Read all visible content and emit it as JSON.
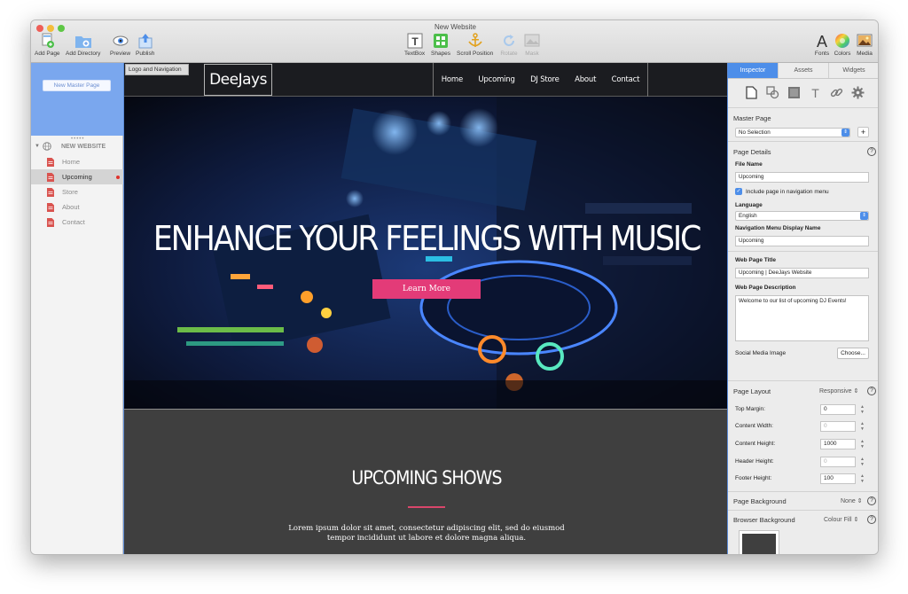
{
  "window": {
    "title": "New Website"
  },
  "toolbar": {
    "left": [
      {
        "label": "Add Page",
        "icon": "add-page-icon"
      },
      {
        "label": "Add Directory",
        "icon": "add-directory-icon"
      },
      {
        "label": "Preview",
        "icon": "preview-eye-icon"
      },
      {
        "label": "Publish",
        "icon": "publish-icon"
      }
    ],
    "center": [
      {
        "label": "TextBox",
        "icon": "textbox-icon"
      },
      {
        "label": "Shapes",
        "icon": "shapes-icon"
      },
      {
        "label": "Scroll Position",
        "icon": "anchor-icon"
      },
      {
        "label": "Rotate",
        "icon": "rotate-icon"
      },
      {
        "label": "Mask",
        "icon": "mask-icon"
      }
    ],
    "right": [
      {
        "label": "Fonts",
        "icon": "fonts-icon"
      },
      {
        "label": "Colors",
        "icon": "colors-icon"
      },
      {
        "label": "Media",
        "icon": "media-icon"
      }
    ]
  },
  "sidebar": {
    "master_button": "New Master Page",
    "site_name": "NEW WEBSITE",
    "pages": [
      {
        "label": "Home"
      },
      {
        "label": "Upcoming"
      },
      {
        "label": "Store"
      },
      {
        "label": "About"
      },
      {
        "label": "Contact"
      }
    ]
  },
  "canvas": {
    "logo_tag": "Logo and Navigation",
    "logo": "DeeJays",
    "nav": [
      "Home",
      "Upcoming",
      "DJ Store",
      "About",
      "Contact"
    ],
    "hero_title": "ENHANCE YOUR FEELINGS WITH MUSIC",
    "hero_button": "Learn More",
    "shows_title": "UPCOMING SHOWS",
    "shows_text": "Lorem ipsum dolor sit amet, consectetur adipiscing elit, sed do eiusmod tempor incididunt ut labore et dolore magna aliqua."
  },
  "inspector": {
    "tabs": [
      "Inspector",
      "Assets",
      "Widgets"
    ],
    "master_page_title": "Master Page",
    "master_page_value": "No Selection",
    "page_details_title": "Page Details",
    "file_name_label": "File Name",
    "file_name_value": "Upcoming",
    "include_nav_label": "Include page in navigation menu",
    "language_label": "Language",
    "language_value": "English",
    "nav_name_label": "Navigation Menu Display Name",
    "nav_name_value": "Upcoming",
    "web_title_label": "Web Page Title",
    "web_title_value": "Upcoming | DeeJays Website",
    "web_desc_label": "Web Page Description",
    "web_desc_value": "Welcome to our list of upcoming DJ Events!",
    "social_label": "Social Media Image",
    "choose_label": "Choose...",
    "page_layout_title": "Page Layout",
    "page_layout_value": "Responsive",
    "layout_rows": [
      {
        "label": "Top Margin:",
        "value": "0",
        "dim": false
      },
      {
        "label": "Content Width:",
        "value": "0",
        "dim": true
      },
      {
        "label": "Content Height:",
        "value": "1000",
        "dim": false
      },
      {
        "label": "Header Height:",
        "value": "0",
        "dim": true
      },
      {
        "label": "Footer Height:",
        "value": "100",
        "dim": false
      }
    ],
    "page_bg_title": "Page Background",
    "page_bg_value": "None",
    "browser_bg_title": "Browser Background",
    "browser_bg_value": "Colour Fill"
  },
  "colors": {
    "accent": "#4d8ee9",
    "hero_button": "#e33b78",
    "master_area": "#7aa7ee"
  }
}
